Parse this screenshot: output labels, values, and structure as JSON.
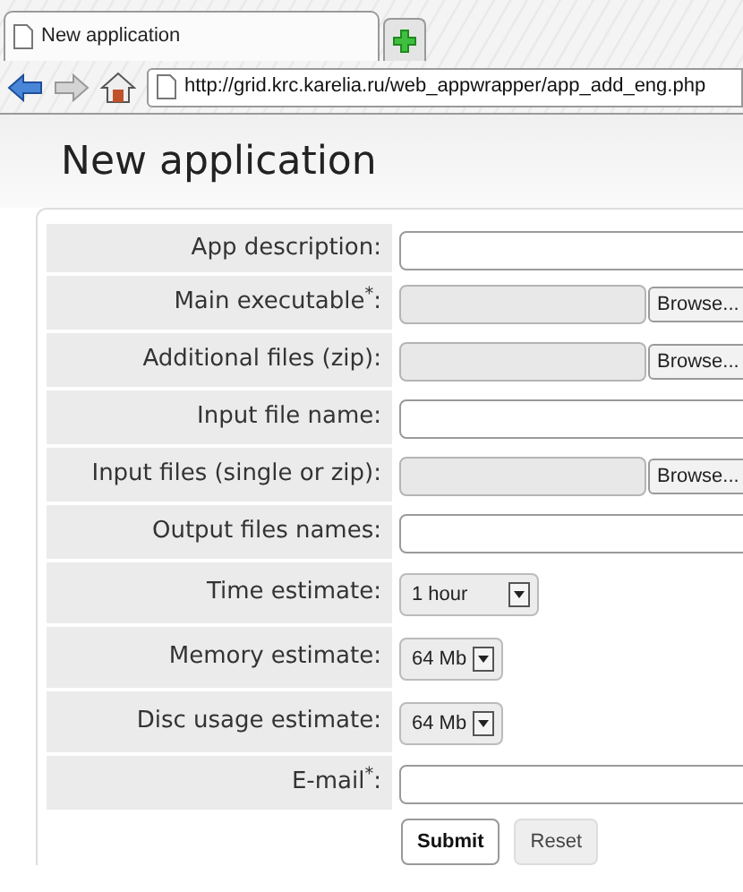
{
  "browser": {
    "tabs": [
      {
        "kind": "page",
        "label": "New application",
        "selected": true
      },
      {
        "kind": "new"
      }
    ],
    "url": "http://grid.krc.karelia.ru/web_appwrapper/app_add_eng.php"
  },
  "page": {
    "title": "New application"
  },
  "form": {
    "fields": [
      {
        "kind": "text",
        "label": "App description:"
      },
      {
        "kind": "file",
        "label": "Main executable$^{*}$:",
        "button": "Browse..."
      },
      {
        "kind": "file",
        "label": "Additional files (zip):",
        "button": "Browse..."
      },
      {
        "kind": "text",
        "label": "Input file name:"
      },
      {
        "kind": "file",
        "label": "Input files (single or zip):",
        "button": "Browse..."
      },
      {
        "kind": "text",
        "label": "Output files names:"
      },
      {
        "kind": "select",
        "label": "Time estimate:",
        "value": "1 hour",
        "wide": true
      },
      {
        "kind": "select",
        "label": "Memory estimate:",
        "value": "64 Mb",
        "wide": false
      },
      {
        "kind": "select",
        "label": "Disc usage estimate:",
        "value": "64 Mb",
        "wide": false
      },
      {
        "kind": "text",
        "label": "E-mail$^{*}$:"
      }
    ],
    "buttons": [
      {
        "label": "Submit",
        "primary": true
      },
      {
        "label": "Reset",
        "primary": false
      }
    ]
  }
}
